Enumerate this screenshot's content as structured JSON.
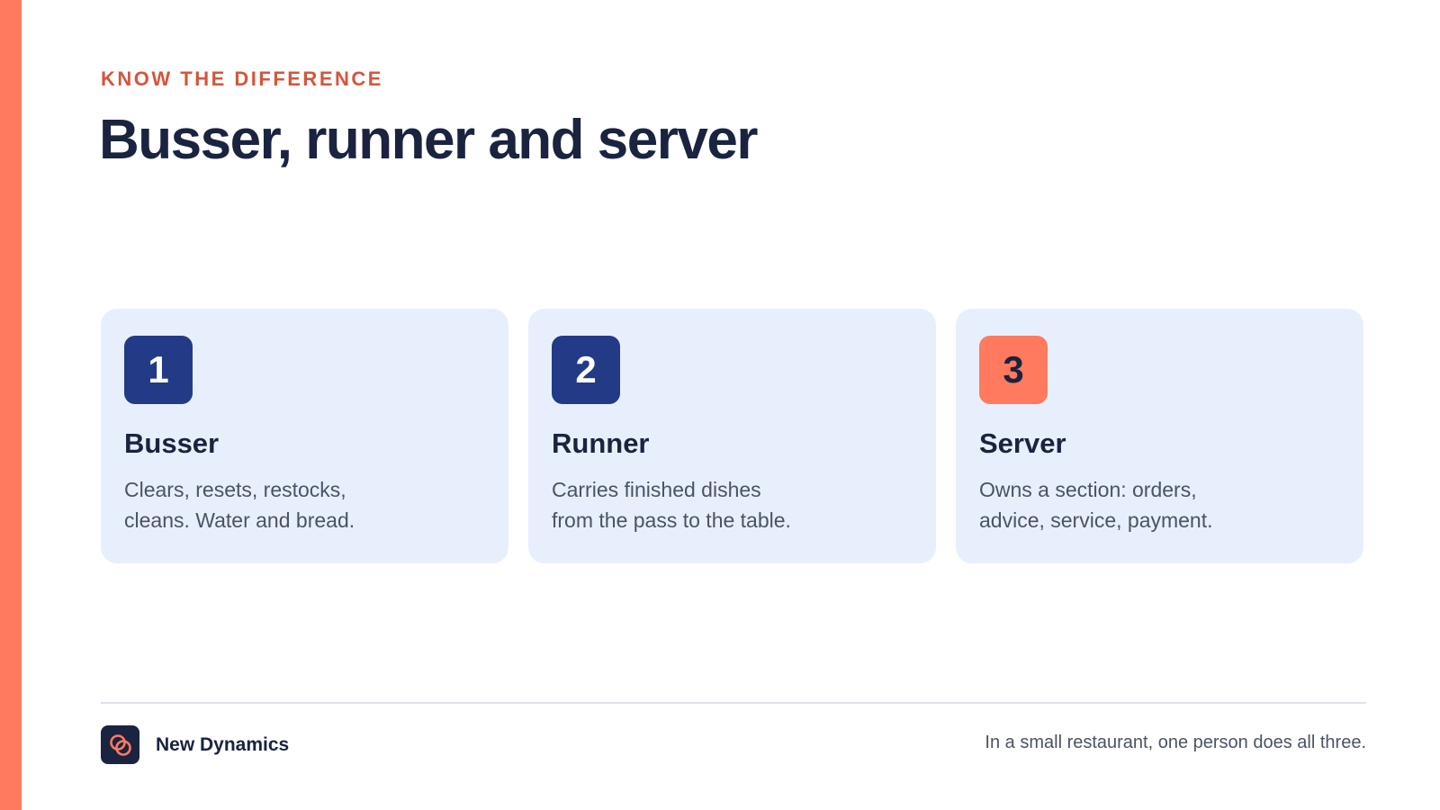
{
  "header": {
    "eyebrow": "KNOW THE DIFFERENCE",
    "title": "Busser, runner and server"
  },
  "cards": [
    {
      "number": "1",
      "title": "Busser",
      "description": "Clears, resets, restocks,\ncleans. Water and bread."
    },
    {
      "number": "2",
      "title": "Runner",
      "description": "Carries finished dishes\nfrom the pass to the table."
    },
    {
      "number": "3",
      "title": "Server",
      "description": "Owns a section: orders,\nadvice, service, payment."
    }
  ],
  "footer": {
    "brand_name": "New Dynamics",
    "logo_icon": "interlinked-rings-icon",
    "note": "In a small restaurant, one person does all three."
  },
  "colors": {
    "accent": "#ff7a5f",
    "eyebrow": "#d4563c",
    "navy": "#233a87",
    "dark_text": "#1a2340",
    "card_background": "#e8effc"
  }
}
